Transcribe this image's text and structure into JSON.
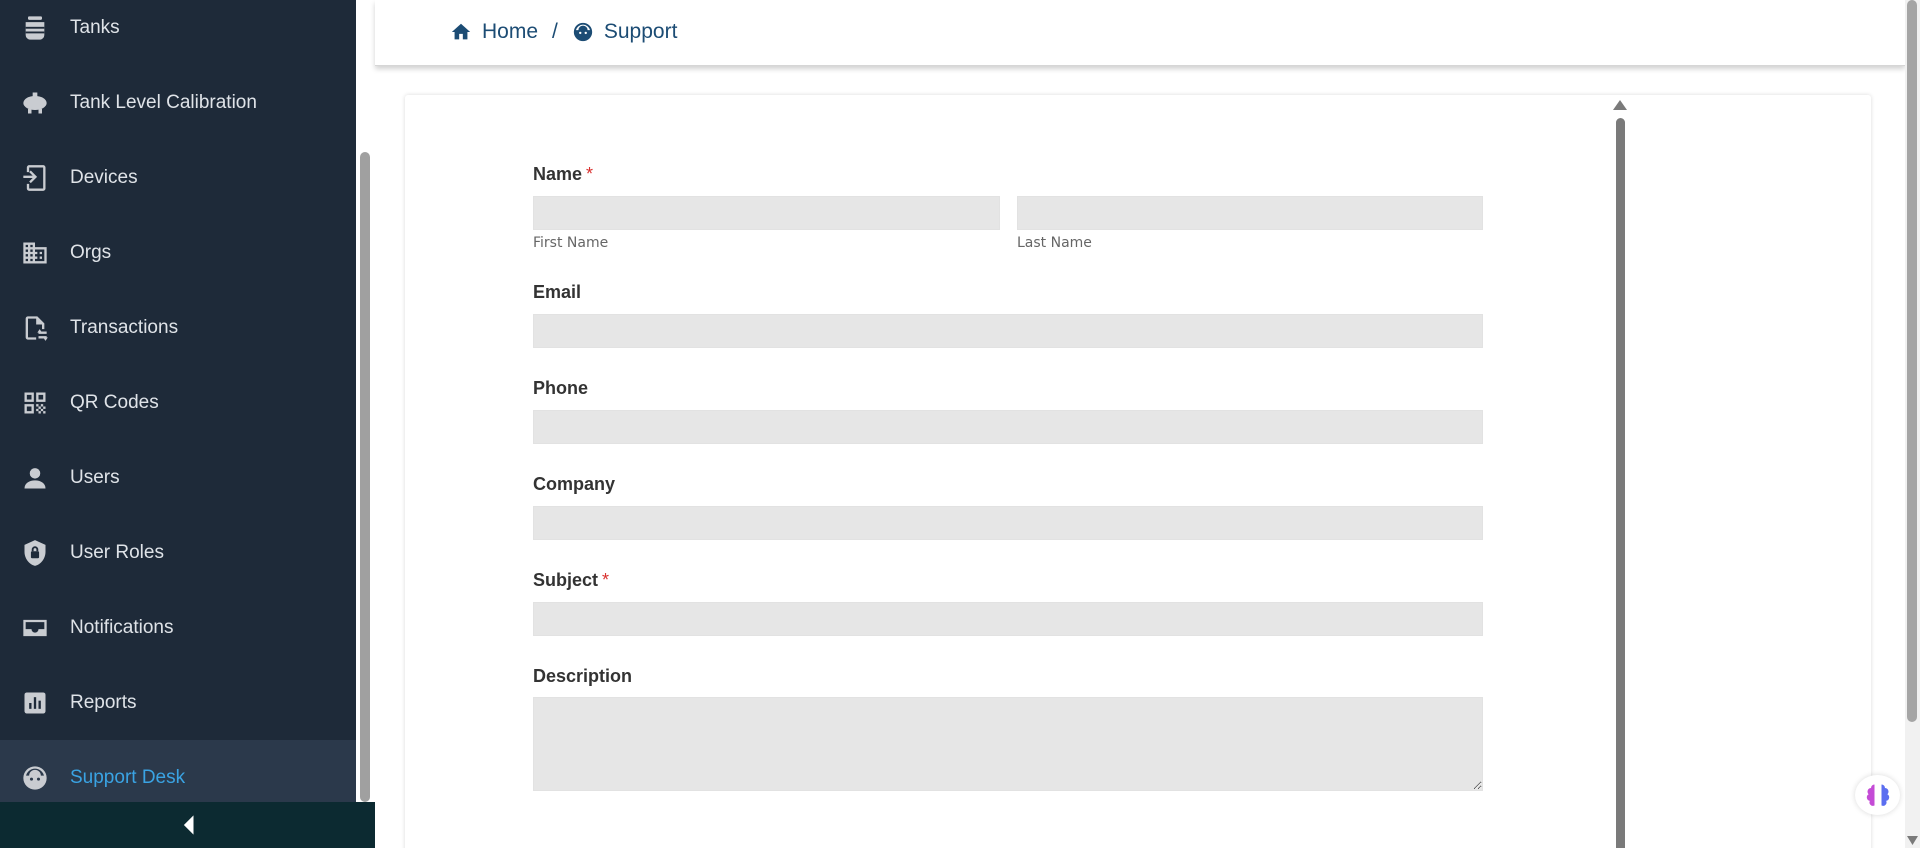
{
  "sidebar": {
    "items": [
      {
        "label": "Tanks",
        "icon": "tank-icon",
        "active": false
      },
      {
        "label": "Tank Level Calibration",
        "icon": "calibration-tank-icon",
        "active": false
      },
      {
        "label": "Devices",
        "icon": "device-icon",
        "active": false
      },
      {
        "label": "Orgs",
        "icon": "building-icon",
        "active": false
      },
      {
        "label": "Transactions",
        "icon": "transaction-document-icon",
        "active": false
      },
      {
        "label": "QR Codes",
        "icon": "qr-code-icon",
        "active": false
      },
      {
        "label": "Users",
        "icon": "user-icon",
        "active": false
      },
      {
        "label": "User Roles",
        "icon": "shield-lock-icon",
        "active": false
      },
      {
        "label": "Notifications",
        "icon": "inbox-icon",
        "active": false
      },
      {
        "label": "Reports",
        "icon": "report-chart-icon",
        "active": false
      },
      {
        "label": "Support Desk",
        "icon": "support-agent-icon",
        "active": true
      }
    ],
    "active_color": "#3aa3e3"
  },
  "breadcrumb": {
    "home": "Home",
    "separator": "/",
    "current": "Support"
  },
  "form": {
    "name_label": "Name",
    "required_mark": "*",
    "first_name_sublabel": "First Name",
    "last_name_sublabel": "Last Name",
    "email_label": "Email",
    "phone_label": "Phone",
    "company_label": "Company",
    "subject_label": "Subject",
    "description_label": "Description",
    "first_name_value": "",
    "last_name_value": "",
    "email_value": "",
    "phone_value": "",
    "company_value": "",
    "subject_value": "",
    "description_value": ""
  },
  "colors": {
    "sidebar_bg": "#1e2a39",
    "breadcrumb": "#1c4c74",
    "required": "#d9302e"
  }
}
